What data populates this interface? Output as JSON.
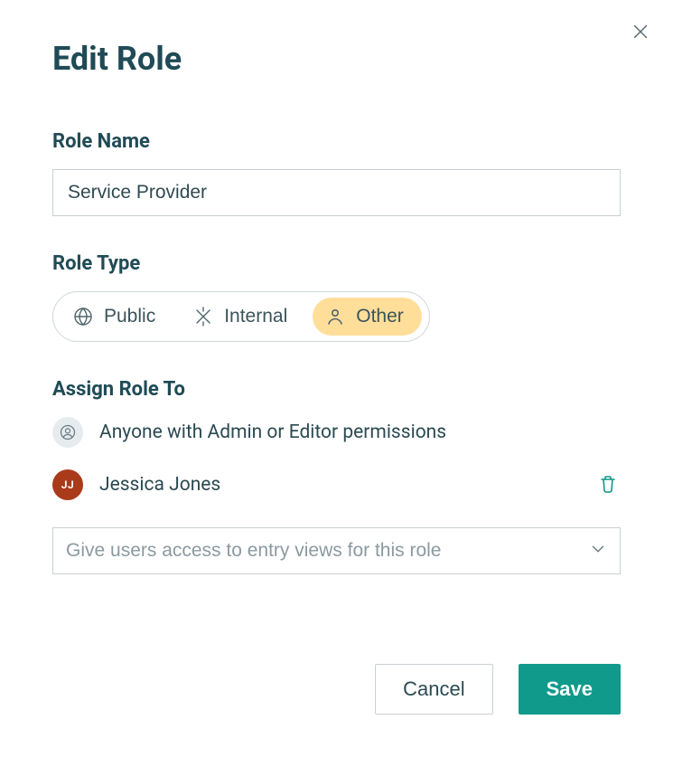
{
  "modal": {
    "title": "Edit Role",
    "roleName": {
      "label": "Role Name",
      "value": "Service Provider"
    },
    "roleType": {
      "label": "Role Type",
      "options": [
        {
          "label": "Public"
        },
        {
          "label": "Internal"
        },
        {
          "label": "Other"
        }
      ],
      "selected": "Other"
    },
    "assign": {
      "label": "Assign Role To",
      "default": "Anyone with Admin or Editor permissions",
      "user": {
        "initials": "JJ",
        "name": "Jessica Jones"
      },
      "placeholder": "Give users access to entry views for this role"
    },
    "actions": {
      "cancel": "Cancel",
      "save": "Save"
    }
  }
}
